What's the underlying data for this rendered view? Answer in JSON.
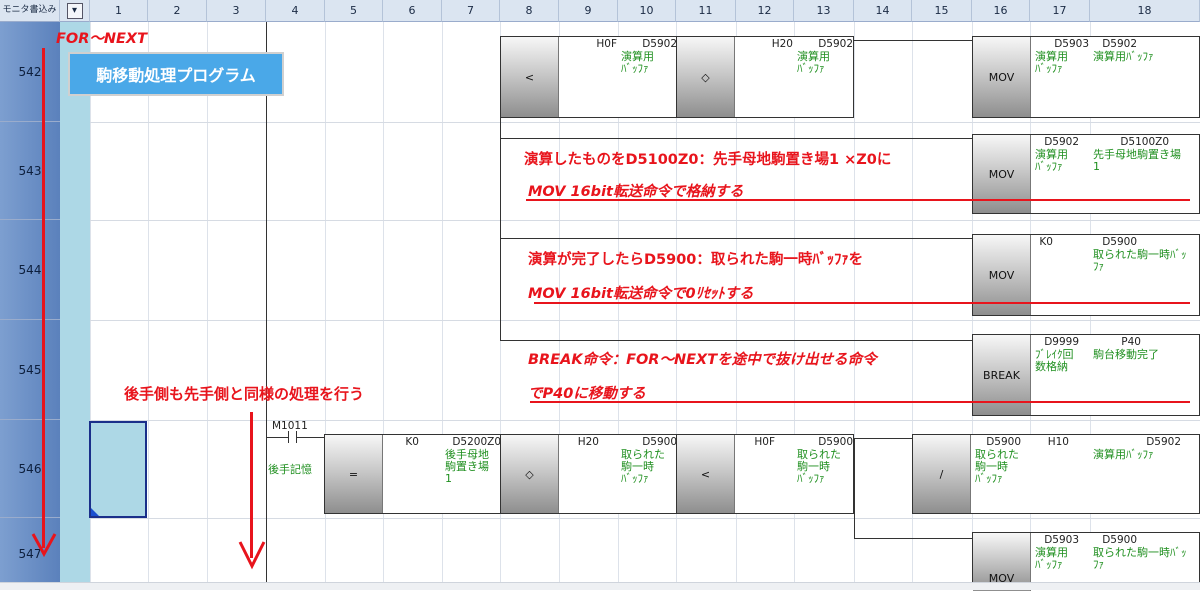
{
  "header": {
    "corner": "モニタ書込み",
    "dropdown": "▾",
    "columns": [
      "1",
      "2",
      "3",
      "4",
      "5",
      "6",
      "7",
      "8",
      "9",
      "10",
      "11",
      "12",
      "13",
      "14",
      "15",
      "16",
      "17",
      "18"
    ]
  },
  "rows": [
    "542",
    "543",
    "544",
    "545",
    "546",
    "547"
  ],
  "annotations": {
    "for_next": "FOR～NEXT",
    "title_box": "駒移動処理プログラム",
    "a543_line1": "演算したものをD5100Z0：先手母地駒置き場1 ×Z0に",
    "a543_line2": "MOV 16bit転送命令で格納する",
    "a544_line1": "演算が完了したらD5900：取られた駒一時ﾊﾞｯﾌｧを",
    "a544_line2": "MOV 16bit転送命令で0ﾘｾｯﾄする",
    "a545_line1": "BREAK命令：FOR～NEXTを途中で抜け出せる命令",
    "a545_line2": "でP40に移動する",
    "a546": "後手側も先手側と同様の処理を行う"
  },
  "ladder": {
    "r542": {
      "cmp1": {
        "op": "<",
        "dev1": "H0F",
        "dev2": "D5902",
        "cmt2": "演算用\nﾊﾞｯﾌｧ"
      },
      "cmp2": {
        "op": "◇",
        "dev1": "H20",
        "dev2": "D5902",
        "cmt2": "演算用\nﾊﾞｯﾌｧ"
      },
      "mov": {
        "op": "MOV",
        "dev1": "D5903",
        "cmt1": "演算用\nﾊﾞｯﾌｧ",
        "dev2": "D5902",
        "cmt2": "演算用ﾊﾞｯﾌｧ"
      }
    },
    "r543": {
      "op": "MOV",
      "dev1": "D5902",
      "cmt1": "演算用\nﾊﾞｯﾌｧ",
      "dev2": "D5100Z0",
      "cmt2": "先手母地駒置き場\n1"
    },
    "r544": {
      "op": "MOV",
      "dev1": "K0",
      "dev2": "D5900",
      "cmt2": "取られた駒一時ﾊﾞｯ\nﾌｧ"
    },
    "r545": {
      "op": "BREAK",
      "dev1": "D9999",
      "cmt1": "ﾌﾞﾚｲｸ回\n数格納",
      "dev2": "P40",
      "cmt2": "駒台移動完了"
    },
    "r546": {
      "contact": {
        "dev": "M1011",
        "cmt": "後手記憶"
      },
      "eq": {
        "op": "=",
        "dev1": "K0",
        "dev2": "D5200Z0",
        "cmt2": "後手母地\n駒置き場\n1"
      },
      "ne": {
        "op": "◇",
        "dev1": "H20",
        "dev2": "D5900",
        "cmt2": "取られた\n駒一時\nﾊﾞｯﾌｧ"
      },
      "lt": {
        "op": "<",
        "dev1": "H0F",
        "dev2": "D5900",
        "cmt2": "取られた\n駒一時\nﾊﾞｯﾌｧ"
      },
      "div": {
        "op": "/",
        "dev1": "D5900",
        "cmt1": "取られた\n駒一時\nﾊﾞｯﾌｧ",
        "dev2": "H10",
        "dev3": "D5902",
        "cmt3": "演算用ﾊﾞｯﾌｧ"
      }
    },
    "r547": {
      "op": "MOV",
      "dev1": "D5903",
      "cmt1": "演算用\nﾊﾞｯﾌｧ",
      "dev2": "D5900",
      "cmt2": "取られた駒一時ﾊﾞｯ\nﾌｧ"
    }
  }
}
